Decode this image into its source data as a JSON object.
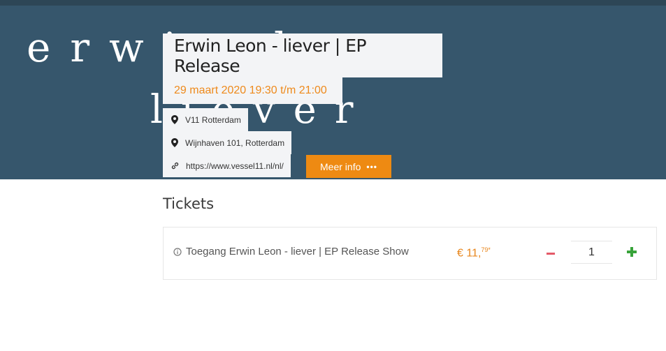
{
  "event": {
    "title": "Erwin Leon - liever | EP Release",
    "date": "29 maart 2020 19:30 t/m 21:00",
    "venue": "V11 Rotterdam",
    "address": "Wijnhaven 101, Rotterdam",
    "website": "https://www.vessel11.nl/nl/",
    "more_info_label": "Meer info",
    "more_info_icon": "ellipsis-icon"
  },
  "hero_art": {
    "line1": "erwin leon",
    "line2": "liever"
  },
  "tickets": {
    "heading": "Tickets",
    "items": [
      {
        "name": "Toegang Erwin Leon - liever | EP Release Show",
        "price_main": "€ 11,",
        "price_cents": "79*",
        "quantity": "1"
      }
    ]
  },
  "colors": {
    "hero_bg": "#36566c",
    "accent": "#ee8a12",
    "minus": "#e45a68",
    "plus": "#38a33a"
  }
}
